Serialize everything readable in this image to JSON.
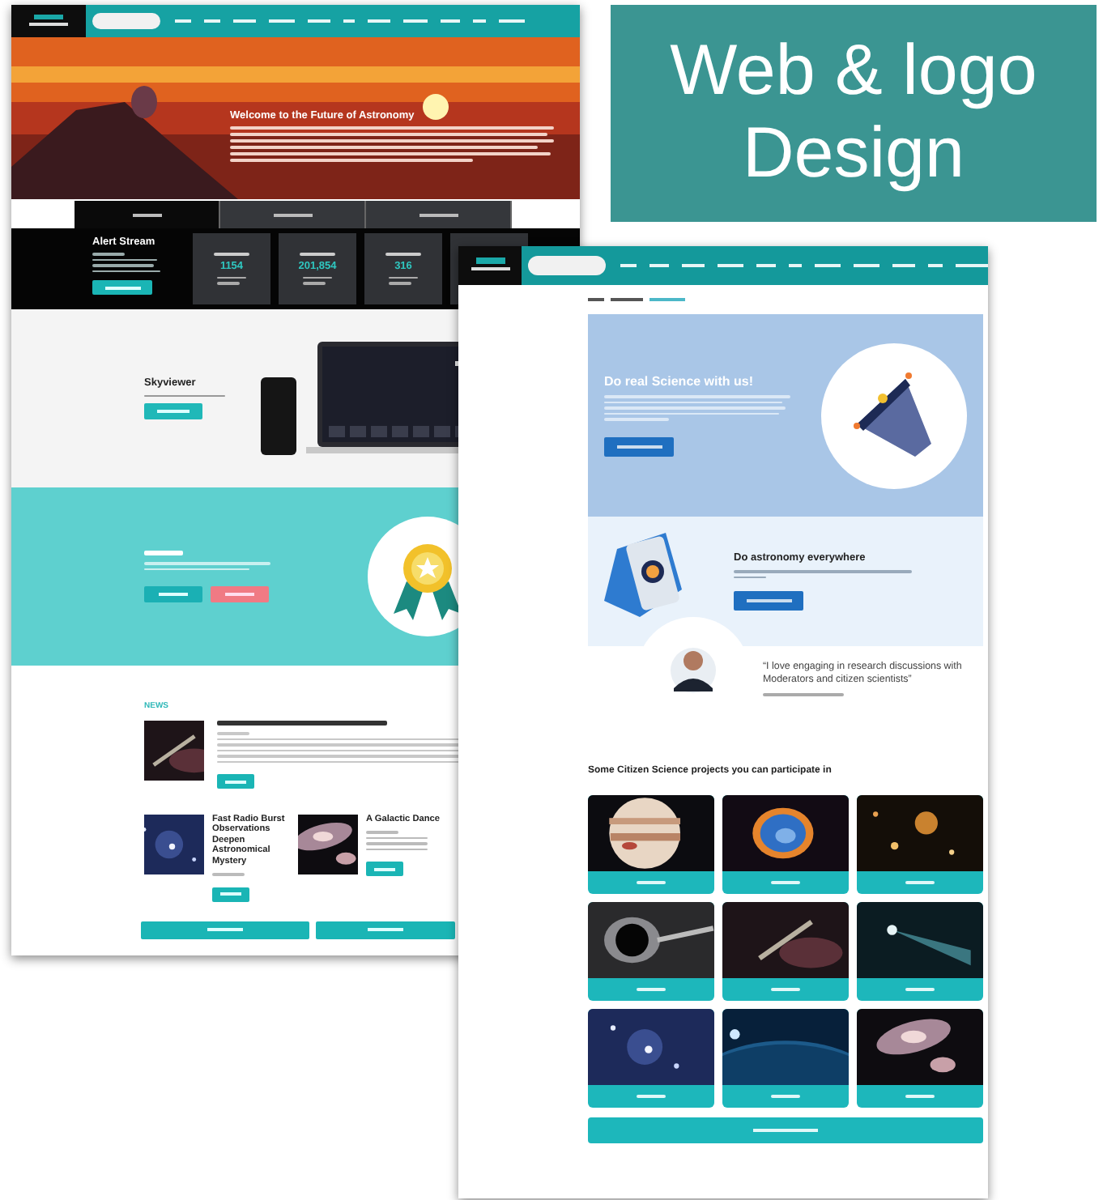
{
  "title_card": {
    "text": "Web & logo Design"
  },
  "left_page": {
    "hero": {
      "title": "Welcome to the Future of Astronomy"
    },
    "tabs": [
      {
        "selected": true
      },
      {
        "selected": false
      },
      {
        "selected": false
      }
    ],
    "alert": {
      "title": "Alert Stream",
      "stats": [
        {
          "kind": "number",
          "value": "1154"
        },
        {
          "kind": "number",
          "value": "201,854"
        },
        {
          "kind": "number",
          "value": "316"
        },
        {
          "kind": "blank"
        }
      ]
    },
    "skyviewer": {
      "title": "Skyviewer"
    },
    "news": {
      "heading": "NEWS",
      "items": [
        {
          "title": "Fast Radio Burst Observations Deepen Astronomical Mystery"
        },
        {
          "title": "A Galactic Dance"
        }
      ]
    }
  },
  "right_page": {
    "hero": {
      "title": "Do real Science with us!"
    },
    "feature": {
      "title": "Do astronomy everywhere"
    },
    "quote": "“I love engaging in research discussions with Moderators and citizen scientists”",
    "projects_heading": "Some Citizen Science projects you can participate in"
  }
}
